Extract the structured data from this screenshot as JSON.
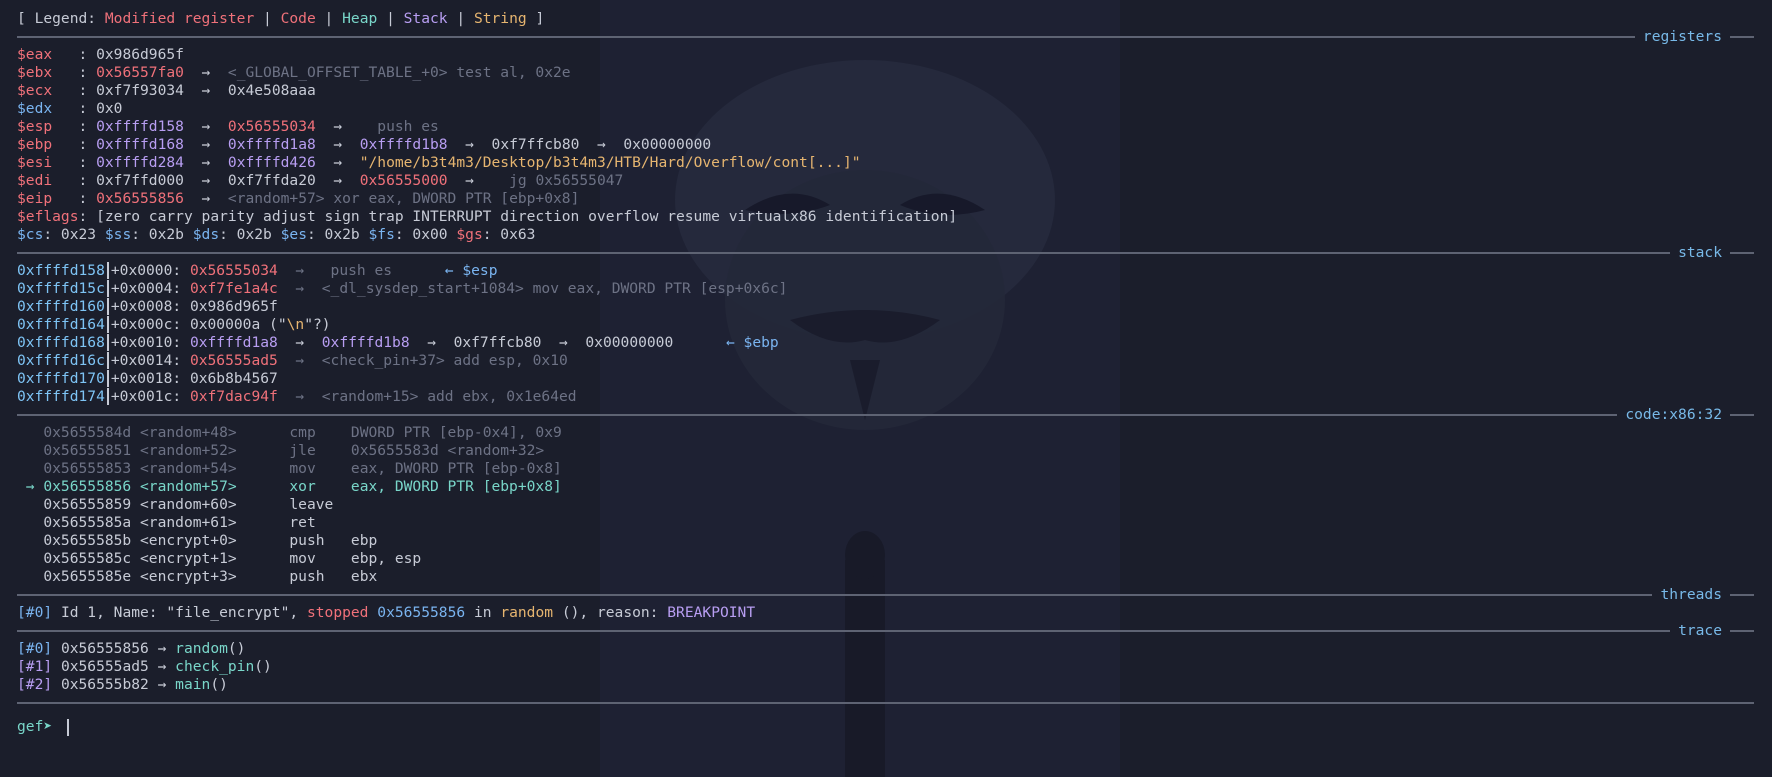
{
  "legend": {
    "prefix": "[ Legend: ",
    "modified": "Modified register",
    "sep1": " | ",
    "code": "Code",
    "sep2": " | ",
    "heap": "Heap",
    "sep3": " | ",
    "stack": "Stack",
    "sep4": " | ",
    "string": "String",
    "suffix": " ]"
  },
  "sections": {
    "registers": "registers",
    "stack": "stack",
    "code": "code:x86:32",
    "threads": "threads",
    "trace": "trace"
  },
  "registers": {
    "eax": {
      "name": "$eax",
      "colon": "   : ",
      "v1": "0x986d965f"
    },
    "ebx": {
      "name": "$ebx",
      "colon": "   : ",
      "v1": "0x56557fa0",
      "a1": "  →  ",
      "v2": "<_GLOBAL_OFFSET_TABLE_+0> test al, 0x2e"
    },
    "ecx": {
      "name": "$ecx",
      "colon": "   : ",
      "v1": "0xf7f93034",
      "a1": "  →  ",
      "v2": "0x4e508aaa"
    },
    "edx": {
      "name": "$edx",
      "colon": "   : ",
      "v1": "0x0"
    },
    "esp": {
      "name": "$esp",
      "colon": "   : ",
      "v1": "0xffffd158",
      "a1": "  →  ",
      "v2": "0x56555034",
      "a2": "  →  ",
      "v3": "  push es"
    },
    "ebp": {
      "name": "$ebp",
      "colon": "   : ",
      "v1": "0xffffd168",
      "a1": "  →  ",
      "v2": "0xffffd1a8",
      "a2": "  →  ",
      "v3": "0xffffd1b8",
      "a3": "  →  ",
      "v4": "0xf7ffcb80",
      "a4": "  →  ",
      "v5": "0x00000000"
    },
    "esi": {
      "name": "$esi",
      "colon": "   : ",
      "v1": "0xffffd284",
      "a1": "  →  ",
      "v2": "0xffffd426",
      "a2": "  →  ",
      "v3": "\"/home/b3t4m3/Desktop/b3t4m3/HTB/Hard/Overflow/cont[...]\""
    },
    "edi": {
      "name": "$edi",
      "colon": "   : ",
      "v1": "0xf7ffd000",
      "a1": "  →  ",
      "v2": "0xf7ffda20",
      "a2": "  →  ",
      "v3": "0x56555000",
      "a3": "  →  ",
      "v4": "  jg 0x56555047"
    },
    "eip": {
      "name": "$eip",
      "colon": "   : ",
      "v1": "0x56555856",
      "a1": "  →  ",
      "v2": "<random+57> xor eax, DWORD PTR [ebp+0x8]"
    },
    "eflags": {
      "name": "$eflags",
      "colon": ": ",
      "v1": "[zero carry parity adjust sign trap INTERRUPT direction overflow resume virtualx86 identification]"
    },
    "segments": [
      {
        "name": "$cs",
        "val": ": 0x23 "
      },
      {
        "name": "$ss",
        "val": ": 0x2b "
      },
      {
        "name": "$ds",
        "val": ": 0x2b "
      },
      {
        "name": "$es",
        "val": ": 0x2b "
      },
      {
        "name": "$fs",
        "val": ": 0x00 "
      },
      {
        "name": "$gs",
        "val": ": 0x63"
      }
    ]
  },
  "stack": [
    {
      "addr": "0xffffd158",
      "off": "+0x0000: ",
      "v1": "0x56555034",
      "rest": "  →   push es      ",
      "note": "← $esp"
    },
    {
      "addr": "0xffffd15c",
      "off": "+0x0004: ",
      "v1": "0xf7fe1a4c",
      "rest": "  →  <_dl_sysdep_start+1084> mov eax, DWORD PTR [esp+0x6c]"
    },
    {
      "addr": "0xffffd160",
      "off": "+0x0008: ",
      "v1": "0x986d965f"
    },
    {
      "addr": "0xffffd164",
      "off": "+0x000c: ",
      "v1": "0x00000a (\"",
      "esc": "\\n",
      "tail": "\"?)"
    },
    {
      "addr": "0xffffd168",
      "off": "+0x0010: ",
      "v1": "0xffffd1a8",
      "a1": "  →  ",
      "v2": "0xffffd1b8",
      "a2": "  →  ",
      "v3": "0xf7ffcb80",
      "a3": "  →  ",
      "v4": "0x00000000",
      "pad": "      ",
      "note": "← $ebp"
    },
    {
      "addr": "0xffffd16c",
      "off": "+0x0014: ",
      "v1": "0x56555ad5",
      "rest": "  →  <check_pin+37> add esp, 0x10"
    },
    {
      "addr": "0xffffd170",
      "off": "+0x0018: ",
      "v1": "0x6b8b4567"
    },
    {
      "addr": "0xffffd174",
      "off": "+0x001c: ",
      "v1": "0xf7dac94f",
      "rest": "  →  <random+15> add ebx, 0x1e64ed"
    }
  ],
  "code": [
    {
      "marker": "   ",
      "addr": "0x5655584d",
      "sym": " <random+48>      ",
      "op": "cmp    ",
      "args": "DWORD PTR [ebp-0x4], 0x9"
    },
    {
      "marker": "   ",
      "addr": "0x56555851",
      "sym": " <random+52>      ",
      "op": "jle    ",
      "args": "0x5655583d <random+32>"
    },
    {
      "marker": "   ",
      "addr": "0x56555853",
      "sym": " <random+54>      ",
      "op": "mov    ",
      "args": "eax, DWORD PTR [ebp-0x8]"
    },
    {
      "marker": " → ",
      "addr": "0x56555856",
      "sym": " <random+57>      ",
      "op": "xor    ",
      "args": "eax, DWORD PTR [ebp+0x8]"
    },
    {
      "marker": "   ",
      "addr": "0x56555859",
      "sym": " <random+60>      ",
      "op": "leave  ",
      "args": ""
    },
    {
      "marker": "   ",
      "addr": "0x5655585a",
      "sym": " <random+61>      ",
      "op": "ret    ",
      "args": ""
    },
    {
      "marker": "   ",
      "addr": "0x5655585b",
      "sym": " <encrypt+0>      ",
      "op": "push   ",
      "args": "ebp"
    },
    {
      "marker": "   ",
      "addr": "0x5655585c",
      "sym": " <encrypt+1>      ",
      "op": "mov    ",
      "args": "ebp, esp"
    },
    {
      "marker": "   ",
      "addr": "0x5655585e",
      "sym": " <encrypt+3>      ",
      "op": "push   ",
      "args": "ebx"
    }
  ],
  "thread": {
    "id": "[#0]",
    "t1": " Id 1, Name: \"file_encrypt\", ",
    "stopped": "stopped",
    "t2": " ",
    "addr": "0x56555856",
    "t3": " in ",
    "func": "random",
    "t4": " (), reason: ",
    "reason": "BREAKPOINT"
  },
  "trace": [
    {
      "idx": "[#0]",
      "addr": " 0x56555856 → ",
      "func": "random",
      "paren": "()"
    },
    {
      "idx": "[#1]",
      "addr": " 0x56555ad5 → ",
      "func": "check_pin",
      "paren": "()"
    },
    {
      "idx": "[#2]",
      "addr": " 0x56555b82 → ",
      "func": "main",
      "paren": "()"
    }
  ],
  "prompt": "gef➤ "
}
